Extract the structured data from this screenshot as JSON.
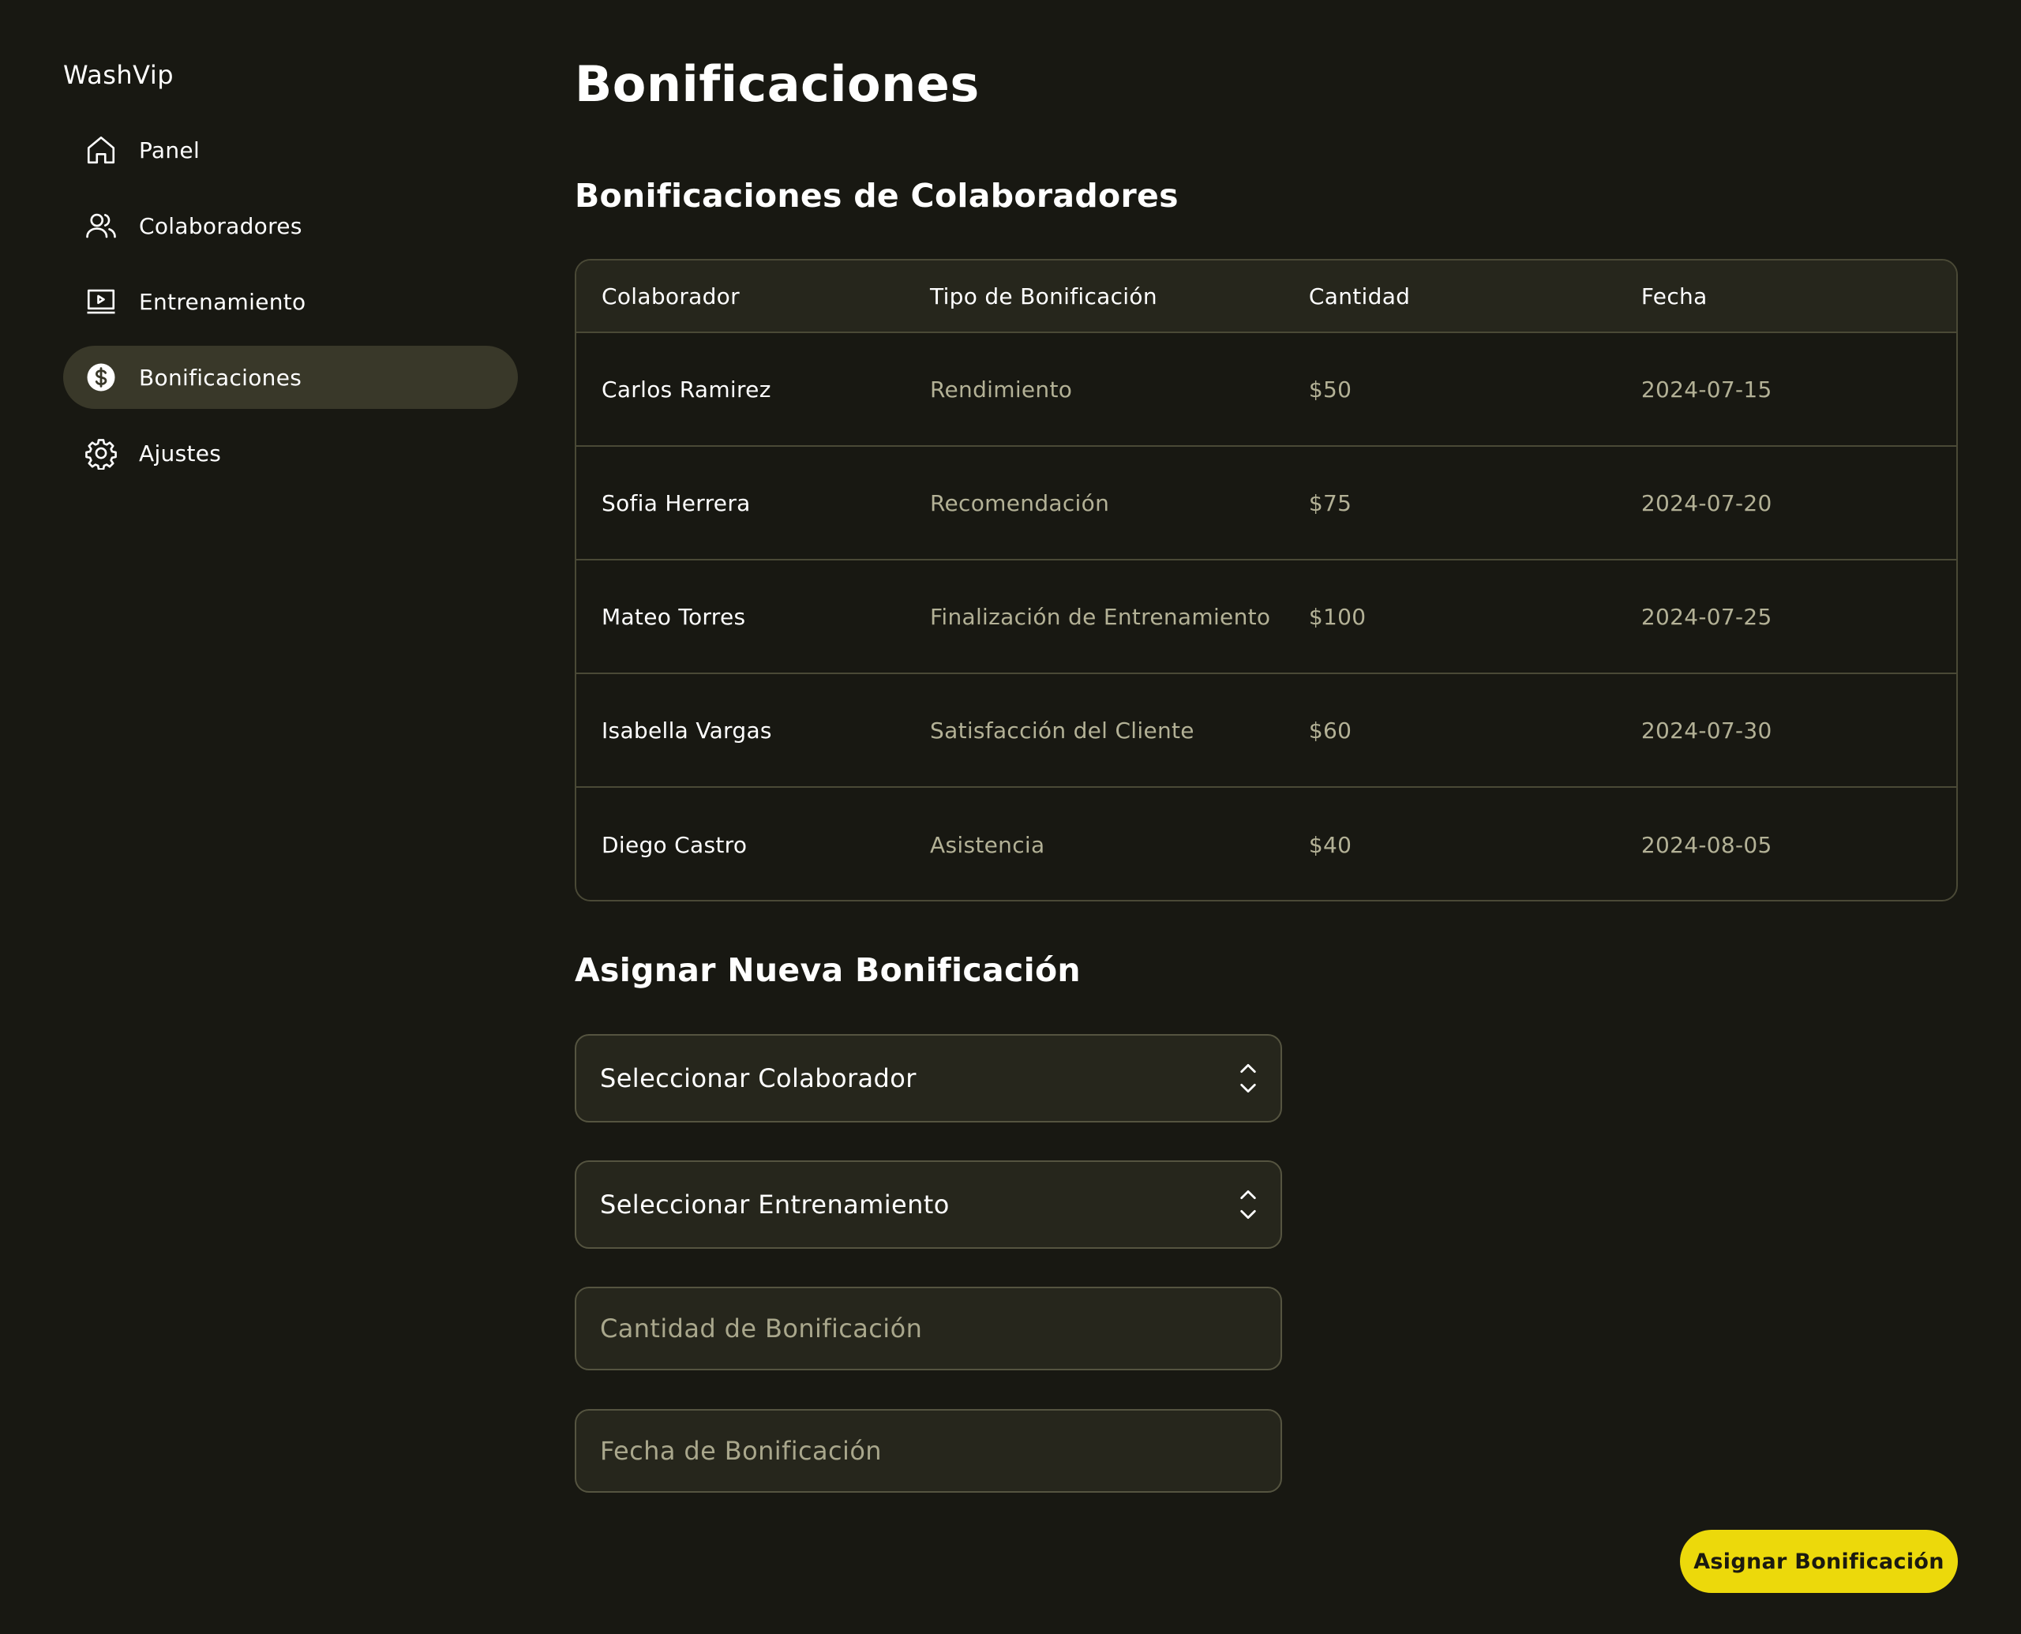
{
  "app": {
    "brand": "WashVip"
  },
  "sidebar": {
    "items": [
      {
        "label": "Panel",
        "icon": "home-icon",
        "active": false
      },
      {
        "label": "Colaboradores",
        "icon": "users-icon",
        "active": false
      },
      {
        "label": "Entrenamiento",
        "icon": "video-play-icon",
        "active": false
      },
      {
        "label": "Bonificaciones",
        "icon": "dollar-circle-icon",
        "active": true
      },
      {
        "label": "Ajustes",
        "icon": "gear-icon",
        "active": false
      }
    ]
  },
  "page": {
    "title": "Bonificaciones"
  },
  "table": {
    "title": "Bonificaciones de Colaboradores",
    "columns": [
      "Colaborador",
      "Tipo de Bonificación",
      "Cantidad",
      "Fecha"
    ],
    "rows": [
      [
        "Carlos Ramirez",
        "Rendimiento",
        "$50",
        "2024-07-15"
      ],
      [
        "Sofia Herrera",
        "Recomendación",
        "$75",
        "2024-07-20"
      ],
      [
        "Mateo Torres",
        "Finalización de Entrenamiento",
        "$100",
        "2024-07-25"
      ],
      [
        "Isabella Vargas",
        "Satisfacción del Cliente",
        "$60",
        "2024-07-30"
      ],
      [
        "Diego Castro",
        "Asistencia",
        "$40",
        "2024-08-05"
      ]
    ]
  },
  "form": {
    "title": "Asignar Nueva Bonificación",
    "collaborator_select": {
      "value": "Seleccionar Colaborador"
    },
    "training_select": {
      "value": "Seleccionar Entrenamiento"
    },
    "amount_input": {
      "value": "",
      "placeholder": "Cantidad de Bonificación"
    },
    "date_input": {
      "value": "",
      "placeholder": "Fecha de Bonificación"
    },
    "submit_label": "Asignar Bonificación"
  },
  "colors": {
    "background": "#181812",
    "active_nav": "#393829",
    "border": "#4a4936",
    "muted_text": "#b3b196",
    "accent": "#ecd90b"
  }
}
